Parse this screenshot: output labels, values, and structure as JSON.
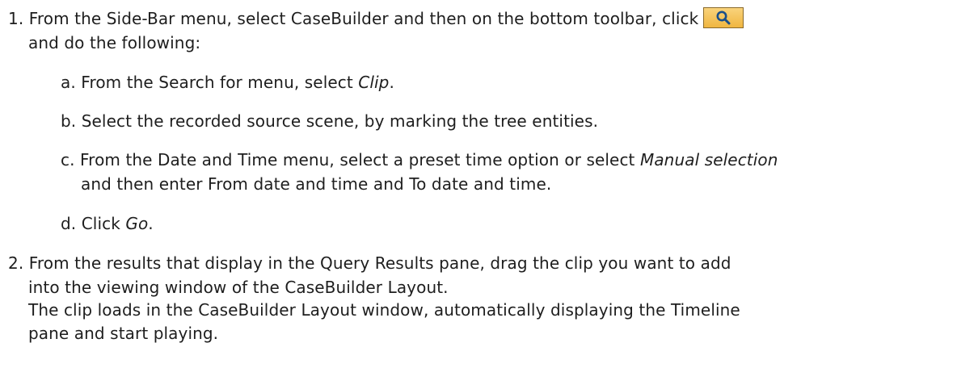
{
  "step1": {
    "number": "1.",
    "line1": "From the Side-Bar menu, select CaseBuilder and then on the bottom toolbar, click",
    "icon": "search-icon",
    "line2": "and do the following:",
    "sub": {
      "a": {
        "letter": "a.",
        "pre": "From the Search for menu, select ",
        "em": "Clip",
        "post": "."
      },
      "b": {
        "letter": "b.",
        "text": "Select the recorded source scene, by marking the tree entities."
      },
      "c": {
        "letter": "c.",
        "pre": "From the Date and Time menu, select a preset time option or select ",
        "em": "Manual selection",
        "line2": "and then enter From date and time and To date and time."
      },
      "d": {
        "letter": "d.",
        "pre": "Click ",
        "em": "Go",
        "post": "."
      }
    }
  },
  "step2": {
    "number": "2.",
    "line1": "From the results that display in the Query Results pane, drag the clip you want to add",
    "line2": "into the viewing window of the CaseBuilder Layout.",
    "line3": "The clip loads in the CaseBuilder Layout window, automatically displaying the Timeline",
    "line4": "pane and start playing."
  },
  "colors": {
    "text": "#1e1e1e",
    "button_fill": "#f0b640",
    "button_border": "#8a6a2a",
    "icon": "#1a4f8a"
  }
}
